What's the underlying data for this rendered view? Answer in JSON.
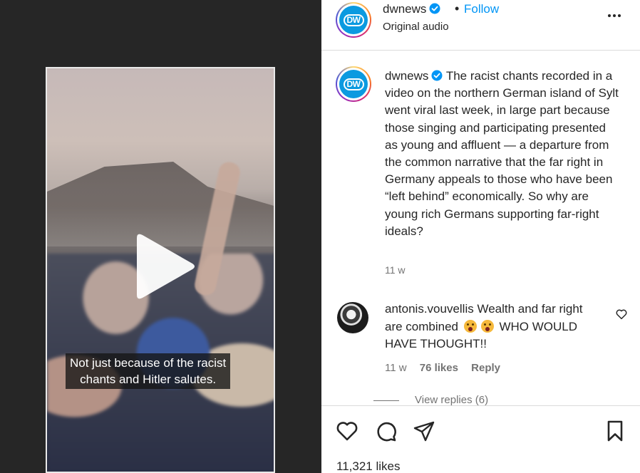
{
  "post": {
    "username": "dwnews",
    "follow_label": "Follow",
    "separator": "•",
    "audio": "Original audio",
    "avatar_text": "DW"
  },
  "video": {
    "caption_line1": "Not just because of the racist",
    "caption_line2": "chants and Hitler salutes."
  },
  "caption": {
    "username": "dwnews",
    "text": "The racist chants recorded in a video on the northern German island of Sylt went viral last week, in large part because those singing and participating presented as young and affluent — a departure from the common narrative that the far right in Germany appeals to those who have been “left behind” economically. So why are young rich Germans supporting far-right ideals?",
    "time": "11 w"
  },
  "comment": {
    "username": "antonis.vouvellis",
    "text_before": "Wealth and far right are combined",
    "text_after": "WHO WOULD HAVE THOUGHT!!",
    "time": "11 w",
    "likes": "76 likes",
    "reply_label": "Reply",
    "view_replies": "View replies (6)"
  },
  "footer": {
    "likes_count": "11,321 likes"
  },
  "colors": {
    "link_blue": "#0095f6",
    "verified_blue": "#0095f6",
    "dw_blue": "#0b9ae0",
    "media_bg": "#262626"
  },
  "icons": [
    "verified-badge-icon",
    "more-options-icon",
    "play-icon",
    "heart-icon",
    "comment-icon",
    "share-icon",
    "bookmark-icon"
  ]
}
